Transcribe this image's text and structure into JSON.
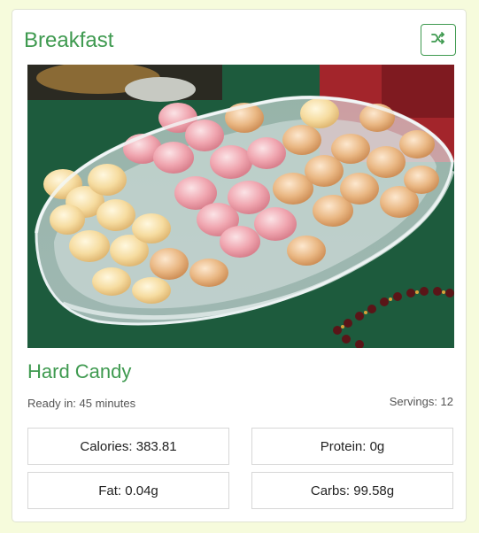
{
  "card": {
    "meal_title": "Breakfast",
    "shuffle_icon": "shuffle-icon",
    "recipe_name": "Hard Candy",
    "ready_in": "Ready in: 45 minutes",
    "servings": "Servings: 12",
    "stats": {
      "calories": "Calories: 383.81",
      "protein": "Protein: 0g",
      "fat": "Fat: 0.04g",
      "carbs": "Carbs: 99.58g"
    }
  },
  "colors": {
    "accent": "#3f9a50",
    "page_background": "#f6fbdc"
  }
}
